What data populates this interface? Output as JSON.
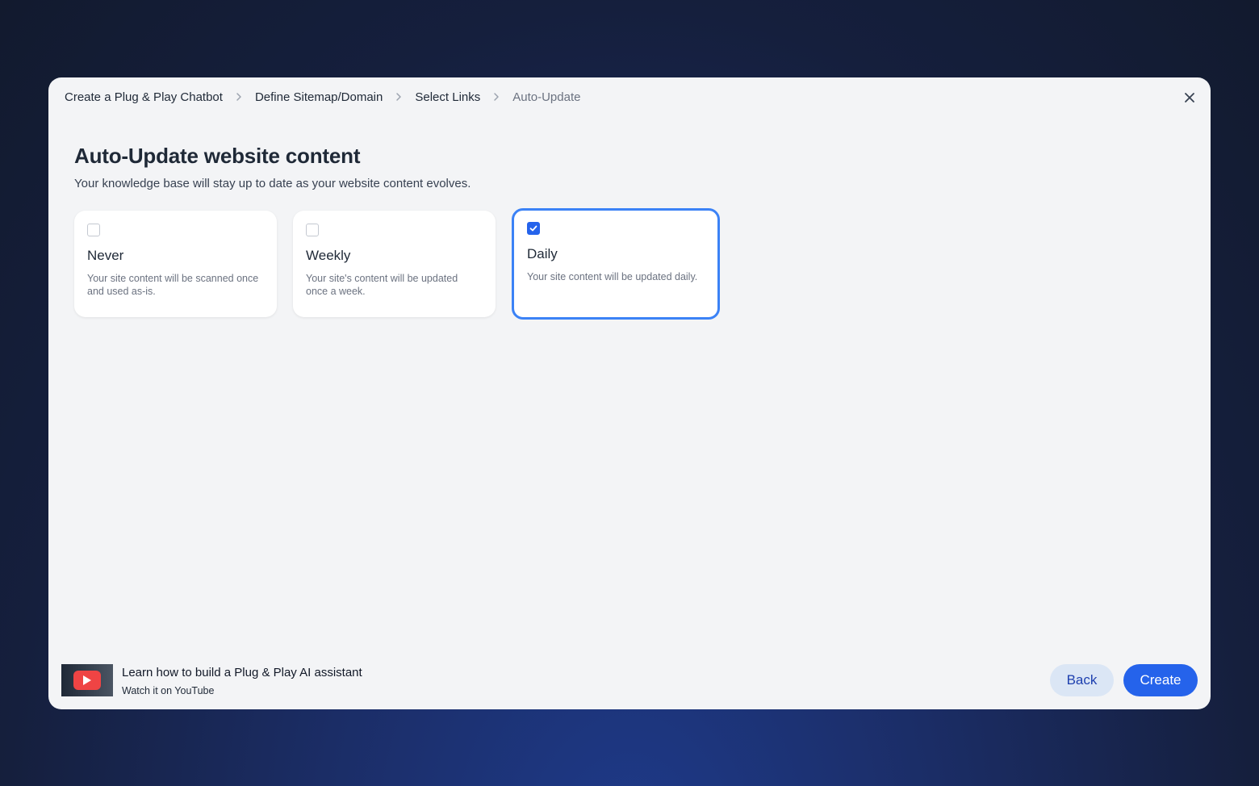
{
  "breadcrumb": {
    "items": [
      {
        "label": "Create a Plug & Play Chatbot"
      },
      {
        "label": "Define Sitemap/Domain"
      },
      {
        "label": "Select Links"
      },
      {
        "label": "Auto-Update"
      }
    ]
  },
  "header": {
    "title": "Auto-Update website content",
    "subtitle": "Your knowledge base will stay up to date as your website content evolves."
  },
  "options": [
    {
      "title": "Never",
      "description": "Your site content will be scanned once and used as-is.",
      "checked": false
    },
    {
      "title": "Weekly",
      "description": "Your site's content will be updated once a week.",
      "checked": false
    },
    {
      "title": "Daily",
      "description": "Your site content will be updated daily.",
      "checked": true
    }
  ],
  "video": {
    "title": "Learn how to build a Plug & Play AI assistant",
    "subtitle": "Watch it on YouTube"
  },
  "actions": {
    "back_label": "Back",
    "create_label": "Create"
  },
  "colors": {
    "accent": "#2563eb",
    "selected_border": "#3b82f6",
    "youtube_red": "#ef4444"
  }
}
